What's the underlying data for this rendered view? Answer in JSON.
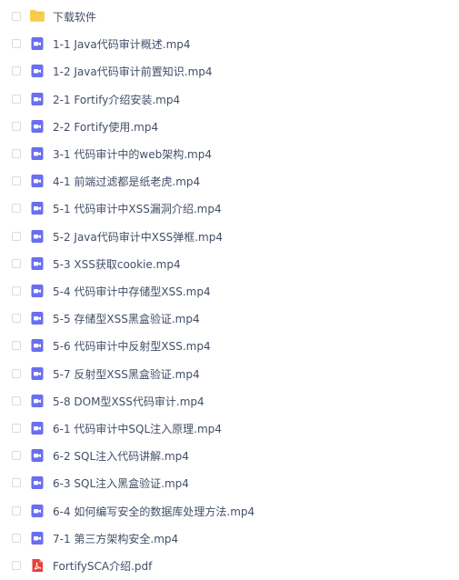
{
  "files": [
    {
      "name": "下载软件",
      "type": "folder"
    },
    {
      "name": "1-1 Java代码审计概述.mp4",
      "type": "video"
    },
    {
      "name": "1-2 Java代码审计前置知识.mp4",
      "type": "video"
    },
    {
      "name": "2-1 Fortify介绍安装.mp4",
      "type": "video"
    },
    {
      "name": "2-2 Fortify使用.mp4",
      "type": "video"
    },
    {
      "name": "3-1 代码审计中的web架构.mp4",
      "type": "video"
    },
    {
      "name": "4-1 前端过滤都是纸老虎.mp4",
      "type": "video"
    },
    {
      "name": "5-1 代码审计中XSS漏洞介绍.mp4",
      "type": "video"
    },
    {
      "name": "5-2 Java代码审计中XSS弹框.mp4",
      "type": "video"
    },
    {
      "name": "5-3 XSS获取cookie.mp4",
      "type": "video"
    },
    {
      "name": "5-4 代码审计中存储型XSS.mp4",
      "type": "video"
    },
    {
      "name": "5-5 存储型XSS黑盒验证.mp4",
      "type": "video"
    },
    {
      "name": "5-6 代码审计中反射型XSS.mp4",
      "type": "video"
    },
    {
      "name": "5-7 反射型XSS黑盒验证.mp4",
      "type": "video"
    },
    {
      "name": "5-8 DOM型XSS代码审计.mp4",
      "type": "video"
    },
    {
      "name": "6-1 代码审计中SQL注入原理.mp4",
      "type": "video"
    },
    {
      "name": "6-2 SQL注入代码讲解.mp4",
      "type": "video"
    },
    {
      "name": "6-3 SQL注入黑盒验证.mp4",
      "type": "video"
    },
    {
      "name": "6-4 如何编写安全的数据库处理方法.mp4",
      "type": "video"
    },
    {
      "name": "7-1 第三方架构安全.mp4",
      "type": "video"
    },
    {
      "name": "FortifySCA介绍.pdf",
      "type": "pdf"
    }
  ],
  "colors": {
    "folder": "#f9cd4b",
    "video": "#6a6ef0",
    "pdf": "#e8413b",
    "text": "#424e67",
    "checkbox_border": "#d7dbe3"
  },
  "icons": {
    "folder": "folder-icon",
    "video": "video-file-icon",
    "pdf": "pdf-file-icon"
  }
}
